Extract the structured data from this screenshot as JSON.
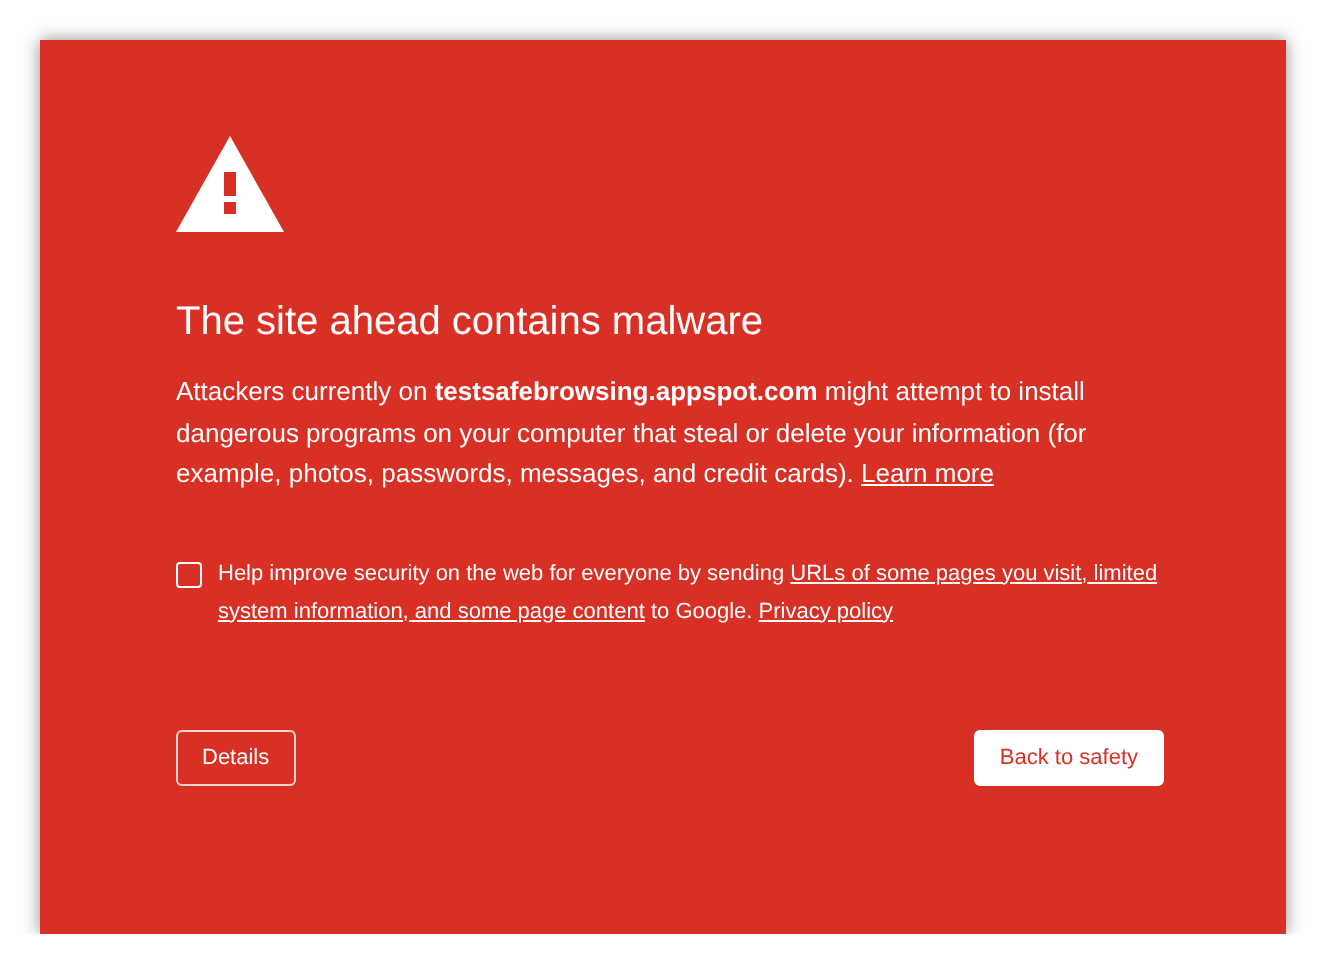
{
  "heading": "The site ahead contains malware",
  "message": {
    "text": "Attackers currently on **testsafebrowsing.appspot.com** might attempt to install dangerous programs on your computer that steal or delete your information (for example, photos, passwords, messages, and credit cards).",
    "link": "Learn more"
  },
  "consent": {
    "checked": false,
    "text_before": "Help improve security on the web for everyone by sending",
    "link_lines": [
      "URLs of some pages you visit, limited",
      "system information, and some page content"
    ],
    "text_after": "to Google.",
    "privacy_link": "Privacy policy"
  },
  "buttons": [
    {
      "kind": "secondary",
      "label": "Details"
    },
    {
      "kind": "primary",
      "label": "Back to safety"
    }
  ]
}
